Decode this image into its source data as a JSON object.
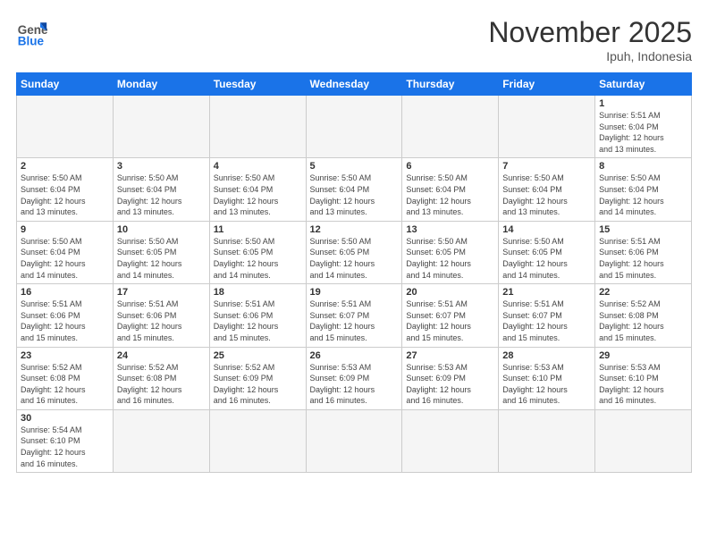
{
  "header": {
    "logo_general": "General",
    "logo_blue": "Blue",
    "month_title": "November 2025",
    "location": "Ipuh, Indonesia"
  },
  "weekdays": [
    "Sunday",
    "Monday",
    "Tuesday",
    "Wednesday",
    "Thursday",
    "Friday",
    "Saturday"
  ],
  "days": [
    {
      "num": "",
      "info": "",
      "empty": true
    },
    {
      "num": "",
      "info": "",
      "empty": true
    },
    {
      "num": "",
      "info": "",
      "empty": true
    },
    {
      "num": "",
      "info": "",
      "empty": true
    },
    {
      "num": "",
      "info": "",
      "empty": true
    },
    {
      "num": "",
      "info": "",
      "empty": true
    },
    {
      "num": "1",
      "info": "Sunrise: 5:51 AM\nSunset: 6:04 PM\nDaylight: 12 hours\nand 13 minutes."
    },
    {
      "num": "2",
      "info": "Sunrise: 5:50 AM\nSunset: 6:04 PM\nDaylight: 12 hours\nand 13 minutes."
    },
    {
      "num": "3",
      "info": "Sunrise: 5:50 AM\nSunset: 6:04 PM\nDaylight: 12 hours\nand 13 minutes."
    },
    {
      "num": "4",
      "info": "Sunrise: 5:50 AM\nSunset: 6:04 PM\nDaylight: 12 hours\nand 13 minutes."
    },
    {
      "num": "5",
      "info": "Sunrise: 5:50 AM\nSunset: 6:04 PM\nDaylight: 12 hours\nand 13 minutes."
    },
    {
      "num": "6",
      "info": "Sunrise: 5:50 AM\nSunset: 6:04 PM\nDaylight: 12 hours\nand 13 minutes."
    },
    {
      "num": "7",
      "info": "Sunrise: 5:50 AM\nSunset: 6:04 PM\nDaylight: 12 hours\nand 13 minutes."
    },
    {
      "num": "8",
      "info": "Sunrise: 5:50 AM\nSunset: 6:04 PM\nDaylight: 12 hours\nand 14 minutes."
    },
    {
      "num": "9",
      "info": "Sunrise: 5:50 AM\nSunset: 6:04 PM\nDaylight: 12 hours\nand 14 minutes."
    },
    {
      "num": "10",
      "info": "Sunrise: 5:50 AM\nSunset: 6:05 PM\nDaylight: 12 hours\nand 14 minutes."
    },
    {
      "num": "11",
      "info": "Sunrise: 5:50 AM\nSunset: 6:05 PM\nDaylight: 12 hours\nand 14 minutes."
    },
    {
      "num": "12",
      "info": "Sunrise: 5:50 AM\nSunset: 6:05 PM\nDaylight: 12 hours\nand 14 minutes."
    },
    {
      "num": "13",
      "info": "Sunrise: 5:50 AM\nSunset: 6:05 PM\nDaylight: 12 hours\nand 14 minutes."
    },
    {
      "num": "14",
      "info": "Sunrise: 5:50 AM\nSunset: 6:05 PM\nDaylight: 12 hours\nand 14 minutes."
    },
    {
      "num": "15",
      "info": "Sunrise: 5:51 AM\nSunset: 6:06 PM\nDaylight: 12 hours\nand 15 minutes."
    },
    {
      "num": "16",
      "info": "Sunrise: 5:51 AM\nSunset: 6:06 PM\nDaylight: 12 hours\nand 15 minutes."
    },
    {
      "num": "17",
      "info": "Sunrise: 5:51 AM\nSunset: 6:06 PM\nDaylight: 12 hours\nand 15 minutes."
    },
    {
      "num": "18",
      "info": "Sunrise: 5:51 AM\nSunset: 6:06 PM\nDaylight: 12 hours\nand 15 minutes."
    },
    {
      "num": "19",
      "info": "Sunrise: 5:51 AM\nSunset: 6:07 PM\nDaylight: 12 hours\nand 15 minutes."
    },
    {
      "num": "20",
      "info": "Sunrise: 5:51 AM\nSunset: 6:07 PM\nDaylight: 12 hours\nand 15 minutes."
    },
    {
      "num": "21",
      "info": "Sunrise: 5:51 AM\nSunset: 6:07 PM\nDaylight: 12 hours\nand 15 minutes."
    },
    {
      "num": "22",
      "info": "Sunrise: 5:52 AM\nSunset: 6:08 PM\nDaylight: 12 hours\nand 15 minutes."
    },
    {
      "num": "23",
      "info": "Sunrise: 5:52 AM\nSunset: 6:08 PM\nDaylight: 12 hours\nand 16 minutes."
    },
    {
      "num": "24",
      "info": "Sunrise: 5:52 AM\nSunset: 6:08 PM\nDaylight: 12 hours\nand 16 minutes."
    },
    {
      "num": "25",
      "info": "Sunrise: 5:52 AM\nSunset: 6:09 PM\nDaylight: 12 hours\nand 16 minutes."
    },
    {
      "num": "26",
      "info": "Sunrise: 5:53 AM\nSunset: 6:09 PM\nDaylight: 12 hours\nand 16 minutes."
    },
    {
      "num": "27",
      "info": "Sunrise: 5:53 AM\nSunset: 6:09 PM\nDaylight: 12 hours\nand 16 minutes."
    },
    {
      "num": "28",
      "info": "Sunrise: 5:53 AM\nSunset: 6:10 PM\nDaylight: 12 hours\nand 16 minutes."
    },
    {
      "num": "29",
      "info": "Sunrise: 5:53 AM\nSunset: 6:10 PM\nDaylight: 12 hours\nand 16 minutes."
    },
    {
      "num": "30",
      "info": "Sunrise: 5:54 AM\nSunset: 6:10 PM\nDaylight: 12 hours\nand 16 minutes."
    },
    {
      "num": "",
      "info": "",
      "empty": true
    },
    {
      "num": "",
      "info": "",
      "empty": true
    },
    {
      "num": "",
      "info": "",
      "empty": true
    },
    {
      "num": "",
      "info": "",
      "empty": true
    },
    {
      "num": "",
      "info": "",
      "empty": true
    },
    {
      "num": "",
      "info": "",
      "empty": true
    }
  ]
}
